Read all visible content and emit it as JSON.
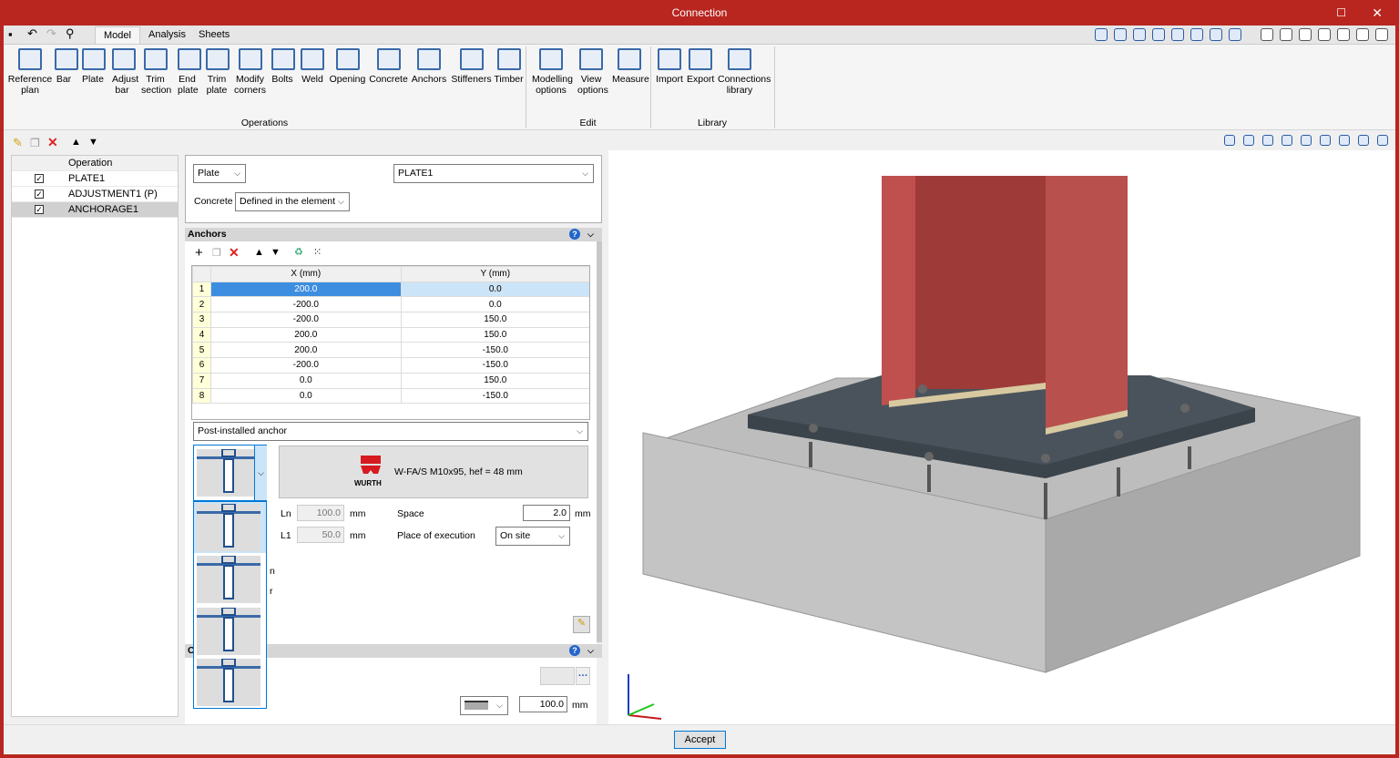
{
  "window": {
    "title": "Connection",
    "accent": "#b8261f"
  },
  "tabs": [
    {
      "label": "Model",
      "active": true
    },
    {
      "label": "Analysis"
    },
    {
      "label": "Sheets"
    }
  ],
  "ribbon": {
    "groups": [
      {
        "label": "Operations",
        "items": [
          "Reference\nplan",
          "Bar",
          "Plate",
          "Adjust\nbar",
          "Trim\nsection",
          "End\nplate",
          "Trim\nplate",
          "Modify\ncorners",
          "Bolts",
          "Weld",
          "Opening",
          "Concrete",
          "Anchors",
          "Stiffeners",
          "Timber"
        ]
      },
      {
        "label": "Edit",
        "items": [
          "Modelling\noptions",
          "View\noptions",
          "Measure"
        ]
      },
      {
        "label": "Library",
        "items": [
          "Import",
          "Export",
          "Connections\nlibrary"
        ]
      }
    ]
  },
  "operations": {
    "header": "Operation",
    "rows": [
      {
        "label": "PLATE1",
        "checked": true
      },
      {
        "label": "ADJUSTMENT1 (P)",
        "checked": true
      },
      {
        "label": "ANCHORAGE1",
        "checked": true,
        "selected": true
      }
    ]
  },
  "element": {
    "type": "Plate",
    "name": "PLATE1",
    "concrete_label": "Concrete",
    "concrete_value": "Defined in the element"
  },
  "anchors": {
    "title": "Anchors",
    "columns": [
      "X (mm)",
      "Y (mm)"
    ],
    "rows": [
      [
        "1",
        "200.0",
        "0.0"
      ],
      [
        "2",
        "-200.0",
        "0.0"
      ],
      [
        "3",
        "-200.0",
        "150.0"
      ],
      [
        "4",
        "200.0",
        "150.0"
      ],
      [
        "5",
        "200.0",
        "-150.0"
      ],
      [
        "6",
        "-200.0",
        "-150.0"
      ],
      [
        "7",
        "0.0",
        "150.0"
      ],
      [
        "8",
        "0.0",
        "-150.0"
      ]
    ],
    "anchor_type": "Post-installed anchor",
    "brand": "WURTH",
    "product": "W-FA/S M10x95, hef = 48 mm",
    "ln_label": "Ln",
    "ln": "100.0",
    "l1_label": "L1",
    "l1": "50.0",
    "unit": "mm",
    "space_label": "Space",
    "space": "2.0",
    "execution_label": "Place of execution",
    "execution": "On site",
    "partial1": "n",
    "partial2": "r"
  },
  "section2": {
    "title_partial": "C",
    "thickness": "100.0",
    "unit": "mm"
  },
  "footer": {
    "accept": "Accept"
  }
}
